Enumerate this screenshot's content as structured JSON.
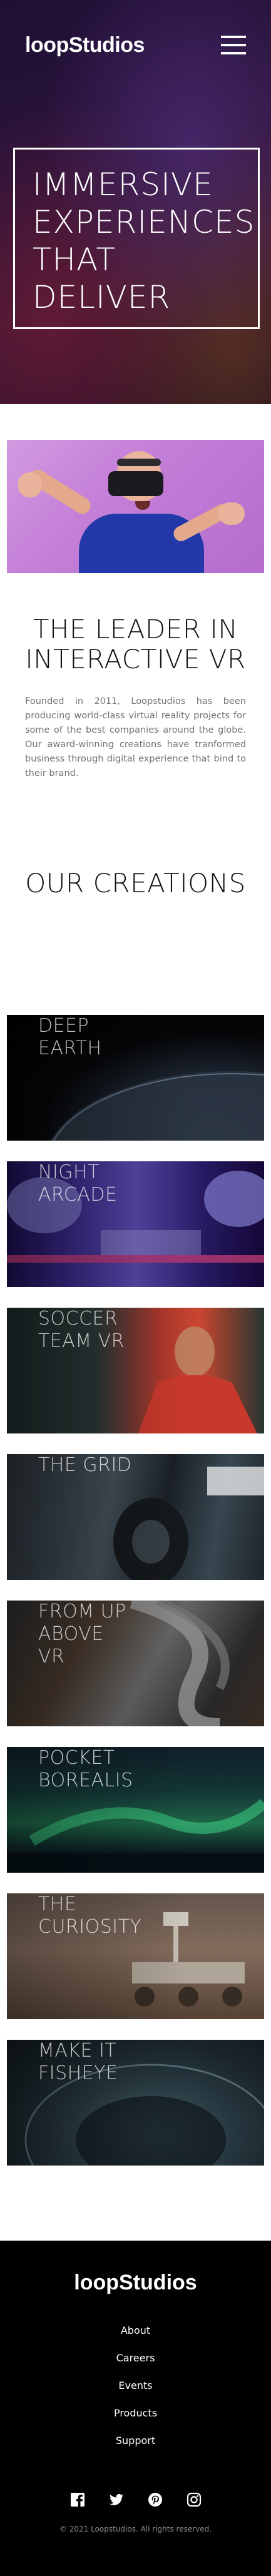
{
  "header": {
    "logo_text": "loopStudios",
    "hero_title": "Immersive\nexperiences\nthat\ndeliver"
  },
  "about": {
    "title": "The leader in\ninteractive VR",
    "text": "Founded in 2011, Loopstudios has been producing world-class virtual reality projects for some of the best companies around the globe. Our award-winning creations have tranformed business through digital experience that bind to their brand."
  },
  "creations": {
    "title": "Our creations",
    "items": [
      {
        "label": "Deep\nearth"
      },
      {
        "label": "Night\narcade"
      },
      {
        "label": "Soccer\nteam VR"
      },
      {
        "label": "The grid"
      },
      {
        "label": "From up\nabove\nVR"
      },
      {
        "label": "Pocket\nborealis"
      },
      {
        "label": "The\ncuriosity"
      },
      {
        "label": "Make it\nfisheye"
      }
    ]
  },
  "footer": {
    "logo_text": "loopStudios",
    "nav": [
      "About",
      "Careers",
      "Events",
      "Products",
      "Support"
    ],
    "socials": [
      "facebook-icon",
      "twitter-icon",
      "pinterest-icon",
      "instagram-icon"
    ],
    "copyright": "© 2021 Loopstudios. All rights reserved."
  }
}
